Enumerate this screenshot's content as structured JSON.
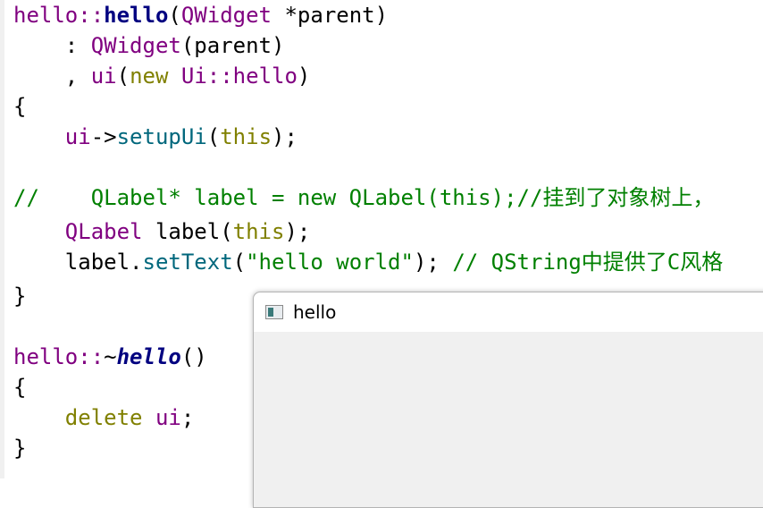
{
  "code": {
    "lines": [
      [
        {
          "t": "hello::",
          "c": "t-purple"
        },
        {
          "t": "hello",
          "c": "t-navy t-bold"
        },
        {
          "t": "(",
          "c": "t-black"
        },
        {
          "t": "QWidget",
          "c": "t-purple"
        },
        {
          "t": " *parent",
          "c": "t-black"
        },
        {
          "t": ")",
          "c": "t-black"
        }
      ],
      [
        {
          "t": "    : ",
          "c": "t-black"
        },
        {
          "t": "QWidget",
          "c": "t-purple"
        },
        {
          "t": "(parent)",
          "c": "t-black"
        }
      ],
      [
        {
          "t": "    , ",
          "c": "t-black"
        },
        {
          "t": "ui",
          "c": "t-purple"
        },
        {
          "t": "(",
          "c": "t-black"
        },
        {
          "t": "new",
          "c": "t-olive"
        },
        {
          "t": " ",
          "c": "t-black"
        },
        {
          "t": "Ui::hello",
          "c": "t-purple"
        },
        {
          "t": ")",
          "c": "t-black"
        }
      ],
      [
        {
          "t": "{",
          "c": "t-black"
        }
      ],
      [
        {
          "t": "    ",
          "c": "t-black"
        },
        {
          "t": "ui",
          "c": "t-purple"
        },
        {
          "t": "->",
          "c": "t-black"
        },
        {
          "t": "setupUi",
          "c": "t-teal"
        },
        {
          "t": "(",
          "c": "t-black"
        },
        {
          "t": "this",
          "c": "t-olive"
        },
        {
          "t": ");",
          "c": "t-black"
        }
      ],
      [],
      [
        {
          "t": "//    QLabel* label = new QLabel(this);//挂到了对象树上，",
          "c": "t-comment"
        }
      ],
      [
        {
          "t": "    ",
          "c": "t-black"
        },
        {
          "t": "QLabel",
          "c": "t-purple"
        },
        {
          "t": " label(",
          "c": "t-black"
        },
        {
          "t": "this",
          "c": "t-olive"
        },
        {
          "t": ");",
          "c": "t-black"
        }
      ],
      [
        {
          "t": "    label.",
          "c": "t-black"
        },
        {
          "t": "setText",
          "c": "t-teal"
        },
        {
          "t": "(",
          "c": "t-black"
        },
        {
          "t": "\"hello world\"",
          "c": "t-string"
        },
        {
          "t": "); ",
          "c": "t-black"
        },
        {
          "t": "// QString中提供了C风格",
          "c": "t-comment"
        }
      ],
      [
        {
          "t": "}",
          "c": "t-black"
        }
      ],
      [],
      [
        {
          "t": "hello::",
          "c": "t-purple"
        },
        {
          "t": "~",
          "c": "t-black"
        },
        {
          "t": "hello",
          "c": "t-navy t-bold t-italic"
        },
        {
          "t": "()",
          "c": "t-black"
        }
      ],
      [
        {
          "t": "{",
          "c": "t-black"
        }
      ],
      [
        {
          "t": "    ",
          "c": "t-black"
        },
        {
          "t": "delete",
          "c": "t-olive"
        },
        {
          "t": " ",
          "c": "t-black"
        },
        {
          "t": "ui",
          "c": "t-purple"
        },
        {
          "t": ";",
          "c": "t-black"
        }
      ],
      [
        {
          "t": "}",
          "c": "t-black"
        }
      ]
    ]
  },
  "qt_window": {
    "title": "hello",
    "icon": "window-icon"
  }
}
